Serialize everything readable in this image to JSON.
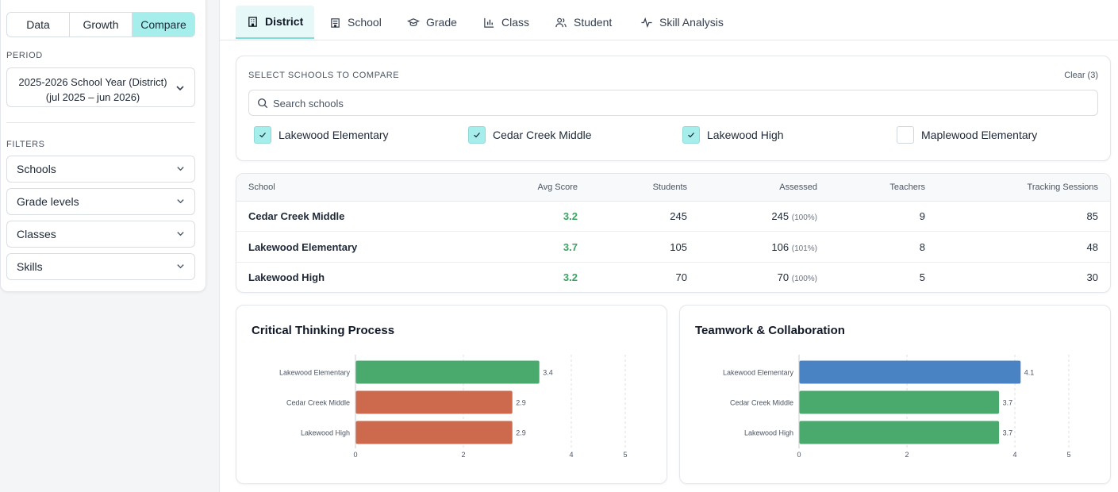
{
  "sidebar": {
    "modes": [
      "Data",
      "Growth",
      "Compare"
    ],
    "active_mode": "Compare",
    "period_label": "PERIOD",
    "period_line1": "2025-2026 School Year (District)",
    "period_line2": "(jul 2025 – jun 2026)",
    "filters_label": "FILTERS",
    "filters": [
      "Schools",
      "Grade levels",
      "Classes",
      "Skills"
    ]
  },
  "tabs": [
    {
      "label": "District",
      "icon": "building-icon",
      "active": true
    },
    {
      "label": "School",
      "icon": "school-icon",
      "active": false
    },
    {
      "label": "Grade",
      "icon": "graduation-cap-icon",
      "active": false
    },
    {
      "label": "Class",
      "icon": "bar-chart-icon",
      "active": false
    },
    {
      "label": "Student",
      "icon": "users-icon",
      "active": false
    },
    {
      "label": "Skill Analysis",
      "icon": "activity-icon",
      "active": false
    }
  ],
  "compare": {
    "title": "SELECT SCHOOLS TO COMPARE",
    "clear_label": "Clear (3)",
    "search_placeholder": "Search schools",
    "schools": [
      {
        "name": "Lakewood Elementary",
        "checked": true
      },
      {
        "name": "Cedar Creek Middle",
        "checked": true
      },
      {
        "name": "Lakewood High",
        "checked": true
      },
      {
        "name": "Maplewood Elementary",
        "checked": false
      }
    ]
  },
  "table": {
    "headers": [
      "School",
      "Avg Score",
      "Students",
      "Assessed",
      "Teachers",
      "Tracking Sessions"
    ],
    "rows": [
      {
        "school": "Cedar Creek Middle",
        "avg": "3.2",
        "students": "245",
        "assessed": "245",
        "assessed_pct": "(100%)",
        "teachers": "9",
        "sessions": "85"
      },
      {
        "school": "Lakewood Elementary",
        "avg": "3.7",
        "students": "105",
        "assessed": "106",
        "assessed_pct": "(101%)",
        "teachers": "8",
        "sessions": "48"
      },
      {
        "school": "Lakewood High",
        "avg": "3.2",
        "students": "70",
        "assessed": "70",
        "assessed_pct": "(100%)",
        "teachers": "5",
        "sessions": "30"
      }
    ]
  },
  "colors": {
    "accent": "#a5eeec",
    "score_green": "#3aa562",
    "bar_green": "#4aaa6e",
    "bar_red": "#cd6a4d",
    "bar_blue": "#4a83c3"
  },
  "chart_data": [
    {
      "type": "bar",
      "orientation": "horizontal",
      "title": "Critical Thinking Process",
      "categories": [
        "Lakewood Elementary",
        "Cedar Creek Middle",
        "Lakewood High"
      ],
      "values": [
        3.4,
        2.9,
        2.9
      ],
      "bar_colors": [
        "#4aaa6e",
        "#cd6a4d",
        "#cd6a4d"
      ],
      "xlim": [
        0,
        5
      ],
      "xticks": [
        0,
        2,
        4,
        5
      ],
      "grid": "vertical dashed"
    },
    {
      "type": "bar",
      "orientation": "horizontal",
      "title": "Teamwork & Collaboration",
      "categories": [
        "Lakewood Elementary",
        "Cedar Creek Middle",
        "Lakewood High"
      ],
      "values": [
        4.1,
        3.7,
        3.7
      ],
      "bar_colors": [
        "#4a83c3",
        "#4aaa6e",
        "#4aaa6e"
      ],
      "xlim": [
        0,
        5
      ],
      "xticks": [
        0,
        2,
        4,
        5
      ],
      "grid": "vertical dashed"
    }
  ]
}
